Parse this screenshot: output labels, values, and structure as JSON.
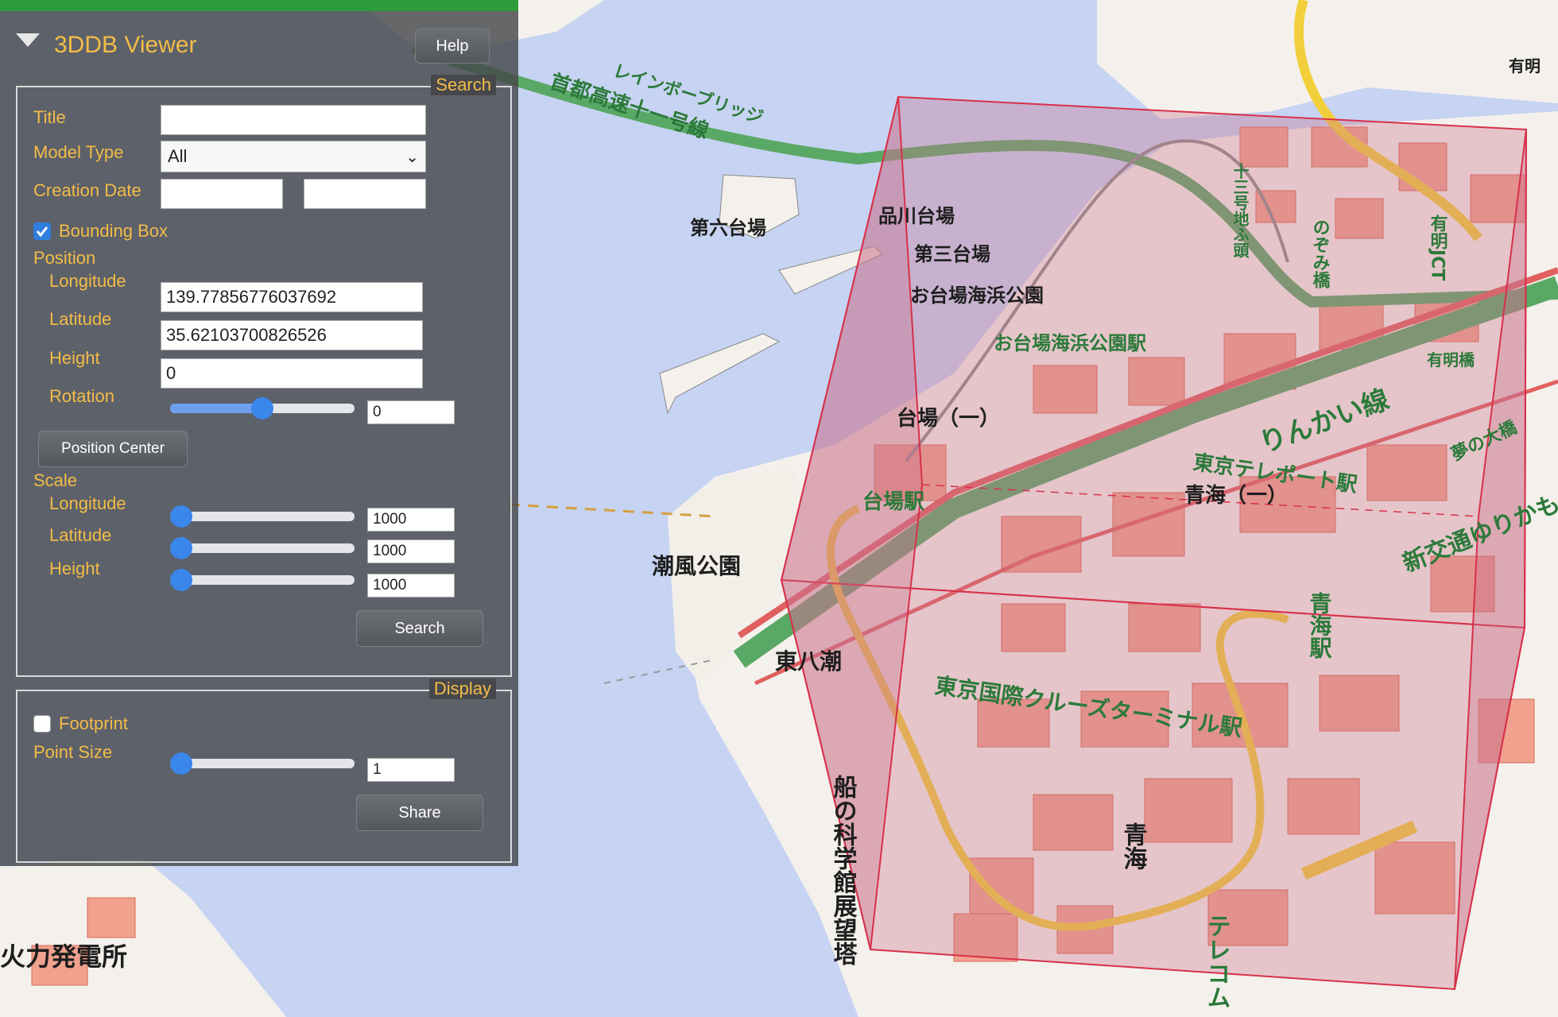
{
  "panel": {
    "title": "3DDB Viewer",
    "help_label": "Help",
    "search_legend": "Search",
    "title_label": "Title",
    "title_value": "",
    "model_type_label": "Model Type",
    "model_type_value": "All",
    "creation_date_label": "Creation Date",
    "creation_date_from": "",
    "creation_date_to": "",
    "bounding_box_label": "Bounding Box",
    "bounding_box_checked": true,
    "position_label": "Position",
    "longitude_label": "Longitude",
    "longitude_value": "139.77856776037692",
    "latitude_label": "Latitude",
    "latitude_value": "35.62103700826526",
    "height_label": "Height",
    "height_value": "0",
    "rotation_label": "Rotation",
    "rotation_value": "0",
    "rotation_slider_level": 0.5,
    "position_center_label": "Position Center",
    "scale_label": "Scale",
    "scale_longitude_label": "Longitude",
    "scale_longitude_value": "1000",
    "scale_latitude_label": "Latitude",
    "scale_latitude_value": "1000",
    "scale_height_label": "Height",
    "scale_height_value": "1000",
    "scale_slider_level": 0.0,
    "search_button_label": "Search",
    "display_legend": "Display",
    "footprint_label": "Footprint",
    "footprint_checked": false,
    "point_size_label": "Point Size",
    "point_size_value": "1",
    "point_size_slider_level": 0.0,
    "share_button_label": "Share"
  },
  "map": {
    "labels": {
      "rainbow_bridge": "レインボーブリッジ",
      "expressway": "首都高速十一号線",
      "daiba6": "第六台場",
      "shinagawa_daiba": "品川台場",
      "daiba3": "第三台場",
      "odaiba_park": "お台場海浜公園",
      "odaiba_station": "お台場海浜公園駅",
      "daiba1": "台場（一）",
      "daiba_station": "台場駅",
      "rinkai": "りんかい線",
      "teleport": "東京テレポート駅",
      "aomi1": "青海（一）",
      "shiokaze": "潮風公園",
      "higashi_yashio": "東八潮",
      "cruise_terminal": "東京国際クルーズターミナル駅",
      "aomi_station": "青海駅",
      "shinkotsu": "新交通ゆりかもめ",
      "museum": "船の科学館展望塔",
      "aomi": "青海",
      "telecom": "テレコム",
      "ariake": "有明",
      "ariake_jct": "有明JCT",
      "ariake_bridge": "有明橋",
      "yume_bridge": "夢の大橋",
      "nozomi_bridge": "のぞみ橋",
      "juni_bridge": "十三号地ふ頭",
      "power_plant": "火力発電所"
    },
    "colors": {
      "water": "#c7d3f2",
      "land": "#f4f1ec",
      "building": "#f0a28e",
      "highway_green": "#5aa866",
      "road_yellow": "#f2cf3a",
      "rail_red": "#e06060",
      "box_fill": "#c8748c",
      "box_edge": "#d8304a"
    }
  }
}
